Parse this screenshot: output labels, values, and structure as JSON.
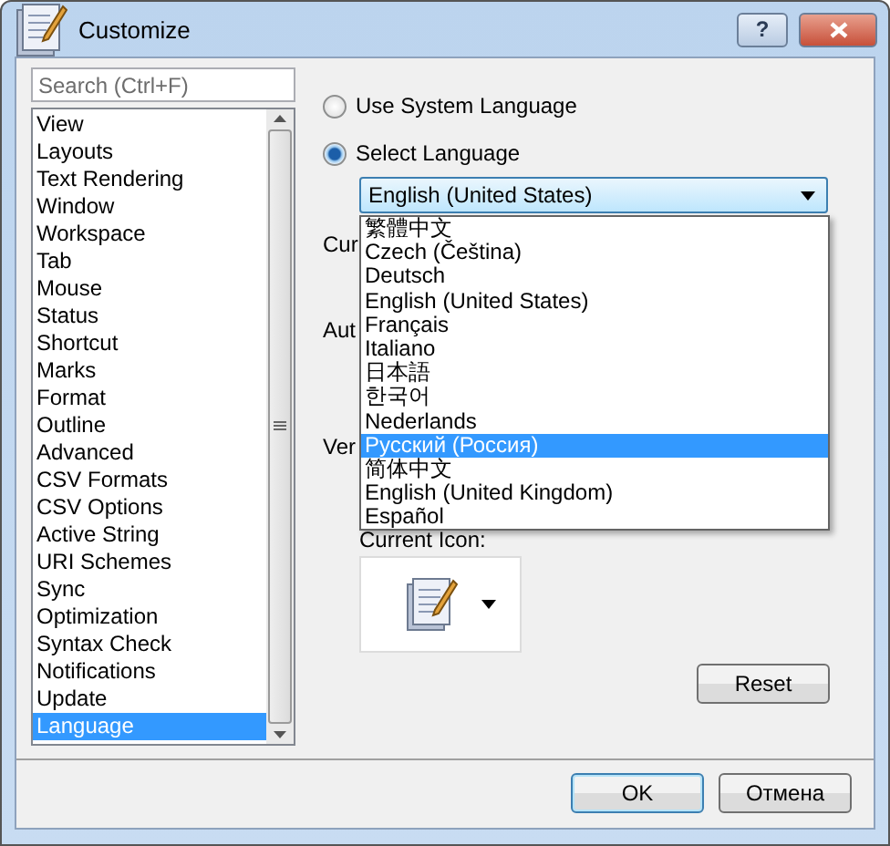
{
  "window": {
    "title": "Customize",
    "buttons": [
      {
        "kind": "help",
        "label": "?"
      },
      {
        "kind": "close"
      }
    ]
  },
  "search": {
    "placeholder": "Search (Ctrl+F)"
  },
  "categories": [
    {
      "label": "View",
      "selected": false
    },
    {
      "label": "Layouts",
      "selected": false
    },
    {
      "label": "Text Rendering",
      "selected": false
    },
    {
      "label": "Window",
      "selected": false
    },
    {
      "label": "Workspace",
      "selected": false
    },
    {
      "label": "Tab",
      "selected": false
    },
    {
      "label": "Mouse",
      "selected": false
    },
    {
      "label": "Status",
      "selected": false
    },
    {
      "label": "Shortcut",
      "selected": false
    },
    {
      "label": "Marks",
      "selected": false
    },
    {
      "label": "Format",
      "selected": false
    },
    {
      "label": "Outline",
      "selected": false
    },
    {
      "label": "Advanced",
      "selected": false
    },
    {
      "label": "CSV Formats",
      "selected": false
    },
    {
      "label": "CSV Options",
      "selected": false
    },
    {
      "label": "Active String",
      "selected": false
    },
    {
      "label": "URI Schemes",
      "selected": false
    },
    {
      "label": "Sync",
      "selected": false
    },
    {
      "label": "Optimization",
      "selected": false
    },
    {
      "label": "Syntax Check",
      "selected": false
    },
    {
      "label": "Notifications",
      "selected": false
    },
    {
      "label": "Update",
      "selected": false
    },
    {
      "label": "Language",
      "selected": true
    }
  ],
  "language_mode": [
    {
      "label": "Use System Language",
      "selected": false
    },
    {
      "label": "Select Language",
      "selected": true
    }
  ],
  "language_select": {
    "value": "English (United States)",
    "options": [
      {
        "label": "繁體中文",
        "highlighted": false
      },
      {
        "label": "Czech (Čeština)",
        "highlighted": false
      },
      {
        "label": "Deutsch",
        "highlighted": false
      },
      {
        "label": "English (United States)",
        "highlighted": false
      },
      {
        "label": "Français",
        "highlighted": false
      },
      {
        "label": "Italiano",
        "highlighted": false
      },
      {
        "label": "日本語",
        "highlighted": false
      },
      {
        "label": "한국어",
        "highlighted": false
      },
      {
        "label": "Nederlands",
        "highlighted": false
      },
      {
        "label": "Русский (Россия)",
        "highlighted": true
      },
      {
        "label": "简体中文",
        "highlighted": false
      },
      {
        "label": "English (United Kingdom)",
        "highlighted": false
      },
      {
        "label": "Español",
        "highlighted": false
      }
    ]
  },
  "hidden_labels": [
    "Cur",
    "Aut",
    "Ver"
  ],
  "current_icon": {
    "label": "Current Icon:"
  },
  "reset_button": "Reset",
  "footer_buttons": [
    {
      "label": "OK",
      "default": true
    },
    {
      "label": "Отмена",
      "default": false
    }
  ]
}
